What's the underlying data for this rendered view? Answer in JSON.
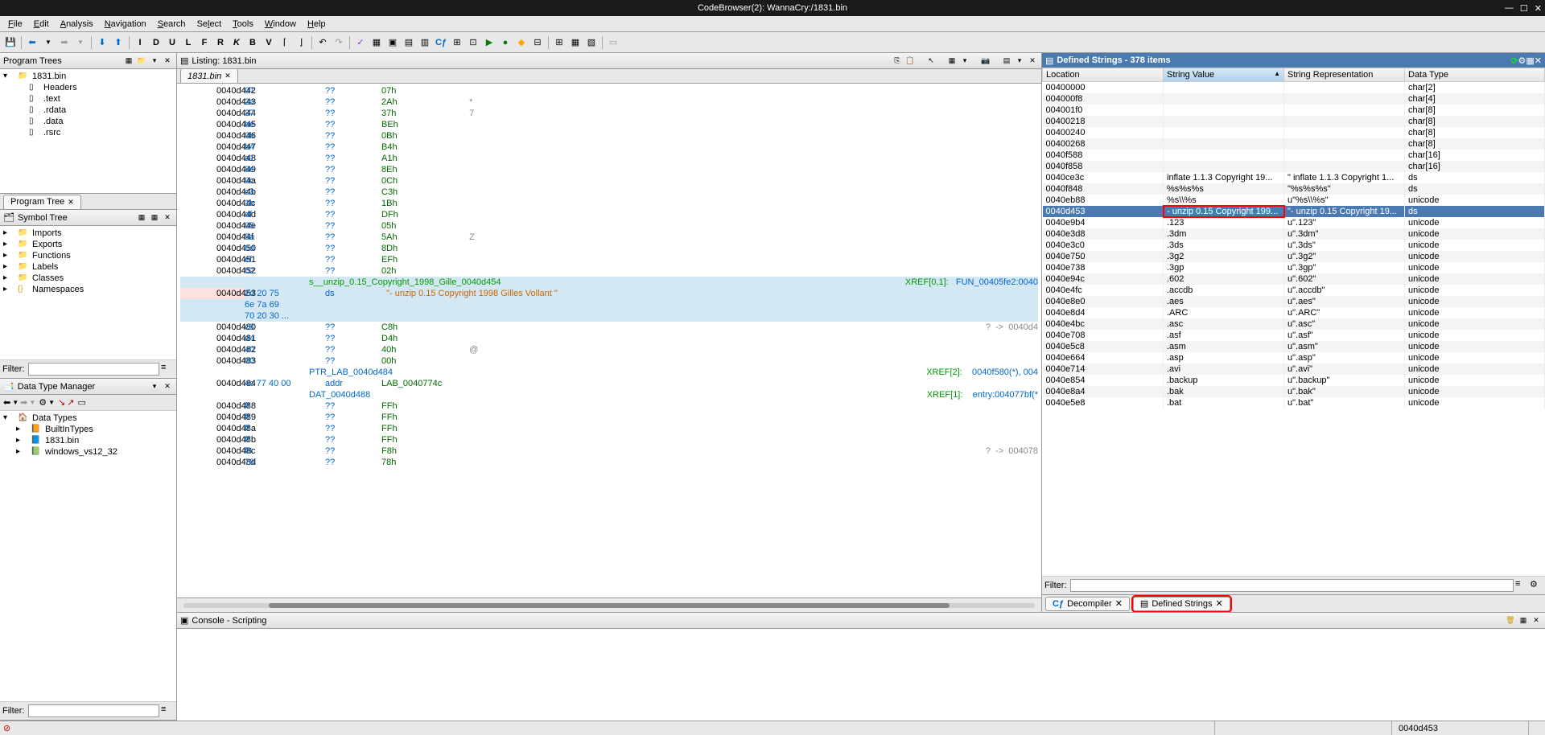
{
  "window_title": "CodeBrowser(2): WannaCry:/1831.bin",
  "menubar": [
    "File",
    "Edit",
    "Analysis",
    "Navigation",
    "Search",
    "Select",
    "Tools",
    "Window",
    "Help"
  ],
  "program_trees": {
    "title": "Program Trees",
    "root": "1831.bin",
    "items": [
      "Headers",
      ".text",
      ".rdata",
      ".data",
      ".rsrc"
    ],
    "tab": "Program Tree"
  },
  "symbol_tree": {
    "title": "Symbol Tree",
    "items": [
      "Imports",
      "Exports",
      "Functions",
      "Labels",
      "Classes",
      "Namespaces"
    ],
    "filter_label": "Filter:"
  },
  "dtm": {
    "title": "Data Type Manager",
    "root": "Data Types",
    "items": [
      "BuiltInTypes",
      "1831.bin",
      "windows_vs12_32"
    ],
    "filter_label": "Filter:"
  },
  "listing": {
    "title": "Listing: 1831.bin",
    "tab": "1831.bin",
    "rows": [
      {
        "addr": "0040d442",
        "bytes": "07",
        "mnm": "??",
        "op": "07h"
      },
      {
        "addr": "0040d443",
        "bytes": "2a",
        "mnm": "??",
        "op": "2Ah",
        "c": "*"
      },
      {
        "addr": "0040d444",
        "bytes": "37",
        "mnm": "??",
        "op": "37h",
        "c": "7"
      },
      {
        "addr": "0040d445",
        "bytes": "be",
        "mnm": "??",
        "op": "BEh"
      },
      {
        "addr": "0040d446",
        "bytes": "0b",
        "mnm": "??",
        "op": "0Bh"
      },
      {
        "addr": "0040d447",
        "bytes": "b4",
        "mnm": "??",
        "op": "B4h"
      },
      {
        "addr": "0040d448",
        "bytes": "a1",
        "mnm": "??",
        "op": "A1h"
      },
      {
        "addr": "0040d449",
        "bytes": "8e",
        "mnm": "??",
        "op": "8Eh"
      },
      {
        "addr": "0040d44a",
        "bytes": "0c",
        "mnm": "??",
        "op": "0Ch"
      },
      {
        "addr": "0040d44b",
        "bytes": "c3",
        "mnm": "??",
        "op": "C3h"
      },
      {
        "addr": "0040d44c",
        "bytes": "1b",
        "mnm": "??",
        "op": "1Bh"
      },
      {
        "addr": "0040d44d",
        "bytes": "df",
        "mnm": "??",
        "op": "DFh"
      },
      {
        "addr": "0040d44e",
        "bytes": "05",
        "mnm": "??",
        "op": "05h"
      },
      {
        "addr": "0040d44f",
        "bytes": "5a",
        "mnm": "??",
        "op": "5Ah",
        "c": "Z"
      },
      {
        "addr": "0040d450",
        "bytes": "8d",
        "mnm": "??",
        "op": "8Dh"
      },
      {
        "addr": "0040d451",
        "bytes": "ef",
        "mnm": "??",
        "op": "EFh"
      },
      {
        "addr": "0040d452",
        "bytes": "02",
        "mnm": "??",
        "op": "02h"
      }
    ],
    "xref1_label": "s__unzip_0.15_Copyright_1998_Gille_0040d454",
    "xref1_x": "XREF[0,1]:",
    "xref1_t": "FUN_00405fe2:0040",
    "dsrow": {
      "addr": "0040d453",
      "bytes": "2d 20 75",
      "mnm": "ds",
      "str": "\"- unzip 0.15 Copyright 1998 Gilles Vollant \""
    },
    "extra_bytes": [
      "6e 7a 69",
      "70 20 30 ..."
    ],
    "rows2": [
      {
        "addr": "0040d480",
        "bytes": "c8",
        "mnm": "??",
        "op": "C8h",
        "rc": "?  ->  0040d4"
      },
      {
        "addr": "0040d481",
        "bytes": "d4",
        "mnm": "??",
        "op": "D4h"
      },
      {
        "addr": "0040d482",
        "bytes": "40",
        "mnm": "??",
        "op": "40h",
        "c": "@"
      },
      {
        "addr": "0040d483",
        "bytes": "00",
        "mnm": "??",
        "op": "00h"
      }
    ],
    "ptr_label": "PTR_LAB_0040d484",
    "ptr_x": "XREF[2]:",
    "ptr_t": "0040f580(*), 004",
    "ptrrow": {
      "addr": "0040d484",
      "bytes": "4c 77 40 00",
      "mnm": "addr",
      "op": "LAB_0040774c"
    },
    "dat_label": "DAT_0040d488",
    "dat_x": "XREF[1]:",
    "dat_t": "entry:004077bf(*",
    "rows3": [
      {
        "addr": "0040d488",
        "bytes": "ff",
        "mnm": "??",
        "op": "FFh"
      },
      {
        "addr": "0040d489",
        "bytes": "ff",
        "mnm": "??",
        "op": "FFh"
      },
      {
        "addr": "0040d48a",
        "bytes": "ff",
        "mnm": "??",
        "op": "FFh"
      },
      {
        "addr": "0040d48b",
        "bytes": "ff",
        "mnm": "??",
        "op": "FFh"
      },
      {
        "addr": "0040d48c",
        "bytes": "f8",
        "mnm": "??",
        "op": "F8h",
        "rc": "?  ->  004078"
      },
      {
        "addr": "0040d48d",
        "bytes": "78",
        "mnm": "??",
        "op": "78h"
      }
    ]
  },
  "strings": {
    "title": "Defined Strings - 378 items",
    "cols": [
      "Location",
      "String Value",
      "String Representation",
      "Data Type"
    ],
    "rows": [
      {
        "l": "00400000",
        "v": "",
        "r": "",
        "t": "char[2]"
      },
      {
        "l": "004000f8",
        "v": "",
        "r": "",
        "t": "char[4]"
      },
      {
        "l": "004001f0",
        "v": "",
        "r": "",
        "t": "char[8]"
      },
      {
        "l": "00400218",
        "v": "",
        "r": "",
        "t": "char[8]"
      },
      {
        "l": "00400240",
        "v": "",
        "r": "",
        "t": "char[8]"
      },
      {
        "l": "00400268",
        "v": "",
        "r": "",
        "t": "char[8]"
      },
      {
        "l": "0040f588",
        "v": "",
        "r": "",
        "t": "char[16]"
      },
      {
        "l": "0040f858",
        "v": "",
        "r": "",
        "t": "char[16]"
      },
      {
        "l": "0040ce3c",
        "v": "inflate 1.1.3 Copyright 19...",
        "r": "\" inflate 1.1.3 Copyright 1...",
        "t": "ds"
      },
      {
        "l": "0040f848",
        "v": "%s%s%s",
        "r": "\"%s%s%s\"",
        "t": "ds"
      },
      {
        "l": "0040eb88",
        "v": "%s\\\\%s",
        "r": "u\"%s\\\\%s\"",
        "t": "unicode"
      },
      {
        "l": "0040d453",
        "v": "- unzip 0.15 Copyright 199...",
        "r": "\"- unzip 0.15 Copyright 19...",
        "t": "ds",
        "sel": true
      },
      {
        "l": "0040e9b4",
        "v": ".123",
        "r": "u\".123\"",
        "t": "unicode"
      },
      {
        "l": "0040e3d8",
        "v": ".3dm",
        "r": "u\".3dm\"",
        "t": "unicode"
      },
      {
        "l": "0040e3c0",
        "v": ".3ds",
        "r": "u\".3ds\"",
        "t": "unicode"
      },
      {
        "l": "0040e750",
        "v": ".3g2",
        "r": "u\".3g2\"",
        "t": "unicode"
      },
      {
        "l": "0040e738",
        "v": ".3gp",
        "r": "u\".3gp\"",
        "t": "unicode"
      },
      {
        "l": "0040e94c",
        "v": ".602",
        "r": "u\".602\"",
        "t": "unicode"
      },
      {
        "l": "0040e4fc",
        "v": ".accdb",
        "r": "u\".accdb\"",
        "t": "unicode"
      },
      {
        "l": "0040e8e0",
        "v": ".aes",
        "r": "u\".aes\"",
        "t": "unicode"
      },
      {
        "l": "0040e8d4",
        "v": ".ARC",
        "r": "u\".ARC\"",
        "t": "unicode"
      },
      {
        "l": "0040e4bc",
        "v": ".asc",
        "r": "u\".asc\"",
        "t": "unicode"
      },
      {
        "l": "0040e708",
        "v": ".asf",
        "r": "u\".asf\"",
        "t": "unicode"
      },
      {
        "l": "0040e5c8",
        "v": ".asm",
        "r": "u\".asm\"",
        "t": "unicode"
      },
      {
        "l": "0040e664",
        "v": ".asp",
        "r": "u\".asp\"",
        "t": "unicode"
      },
      {
        "l": "0040e714",
        "v": ".avi",
        "r": "u\".avi\"",
        "t": "unicode"
      },
      {
        "l": "0040e854",
        "v": ".backup",
        "r": "u\".backup\"",
        "t": "unicode"
      },
      {
        "l": "0040e8a4",
        "v": ".bak",
        "r": "u\".bak\"",
        "t": "unicode"
      },
      {
        "l": "0040e5e8",
        "v": ".bat",
        "r": "u\".bat\"",
        "t": "unicode"
      }
    ],
    "filter_label": "Filter:",
    "tabs": [
      "Decompiler",
      "Defined Strings"
    ]
  },
  "console": {
    "title": "Console - Scripting"
  },
  "status_addr": "0040d453"
}
